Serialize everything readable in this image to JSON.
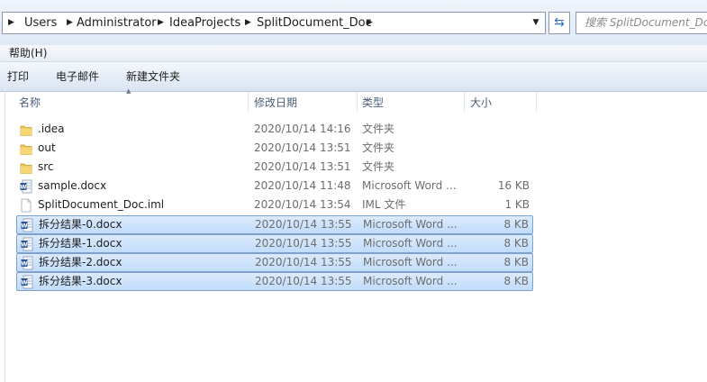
{
  "address": {
    "crumbs": [
      "Users",
      "Administrator",
      "IdeaProjects",
      "SplitDocument_Doc"
    ],
    "search_placeholder": "搜索 SplitDocument_Doc"
  },
  "menu": {
    "help": "帮助(H)"
  },
  "toolbar": {
    "print": "打印",
    "email": "电子邮件",
    "new_folder": "新建文件夹"
  },
  "columns": {
    "name": "名称",
    "date": "修改日期",
    "type": "类型",
    "size": "大小"
  },
  "files": [
    {
      "name": ".idea",
      "date": "2020/10/14 14:16",
      "type": "文件夹",
      "size": "",
      "icon": "folder-icon",
      "selected": false
    },
    {
      "name": "out",
      "date": "2020/10/14 13:51",
      "type": "文件夹",
      "size": "",
      "icon": "folder-icon",
      "selected": false
    },
    {
      "name": "src",
      "date": "2020/10/14 13:51",
      "type": "文件夹",
      "size": "",
      "icon": "folder-icon",
      "selected": false
    },
    {
      "name": "sample.docx",
      "date": "2020/10/14 11:48",
      "type": "Microsoft Word ...",
      "size": "16 KB",
      "icon": "word-doc-icon",
      "selected": false
    },
    {
      "name": "SplitDocument_Doc.iml",
      "date": "2020/10/14 13:54",
      "type": "IML 文件",
      "size": "1 KB",
      "icon": "blank-file-icon",
      "selected": false
    },
    {
      "name": "拆分结果-0.docx",
      "date": "2020/10/14 13:55",
      "type": "Microsoft Word ...",
      "size": "8 KB",
      "icon": "word-doc-icon",
      "selected": true
    },
    {
      "name": "拆分结果-1.docx",
      "date": "2020/10/14 13:55",
      "type": "Microsoft Word ...",
      "size": "8 KB",
      "icon": "word-doc-icon",
      "selected": true
    },
    {
      "name": "拆分结果-2.docx",
      "date": "2020/10/14 13:55",
      "type": "Microsoft Word ...",
      "size": "8 KB",
      "icon": "word-doc-icon",
      "selected": true
    },
    {
      "name": "拆分结果-3.docx",
      "date": "2020/10/14 13:55",
      "type": "Microsoft Word ...",
      "size": "8 KB",
      "icon": "word-doc-icon",
      "selected": true
    }
  ]
}
